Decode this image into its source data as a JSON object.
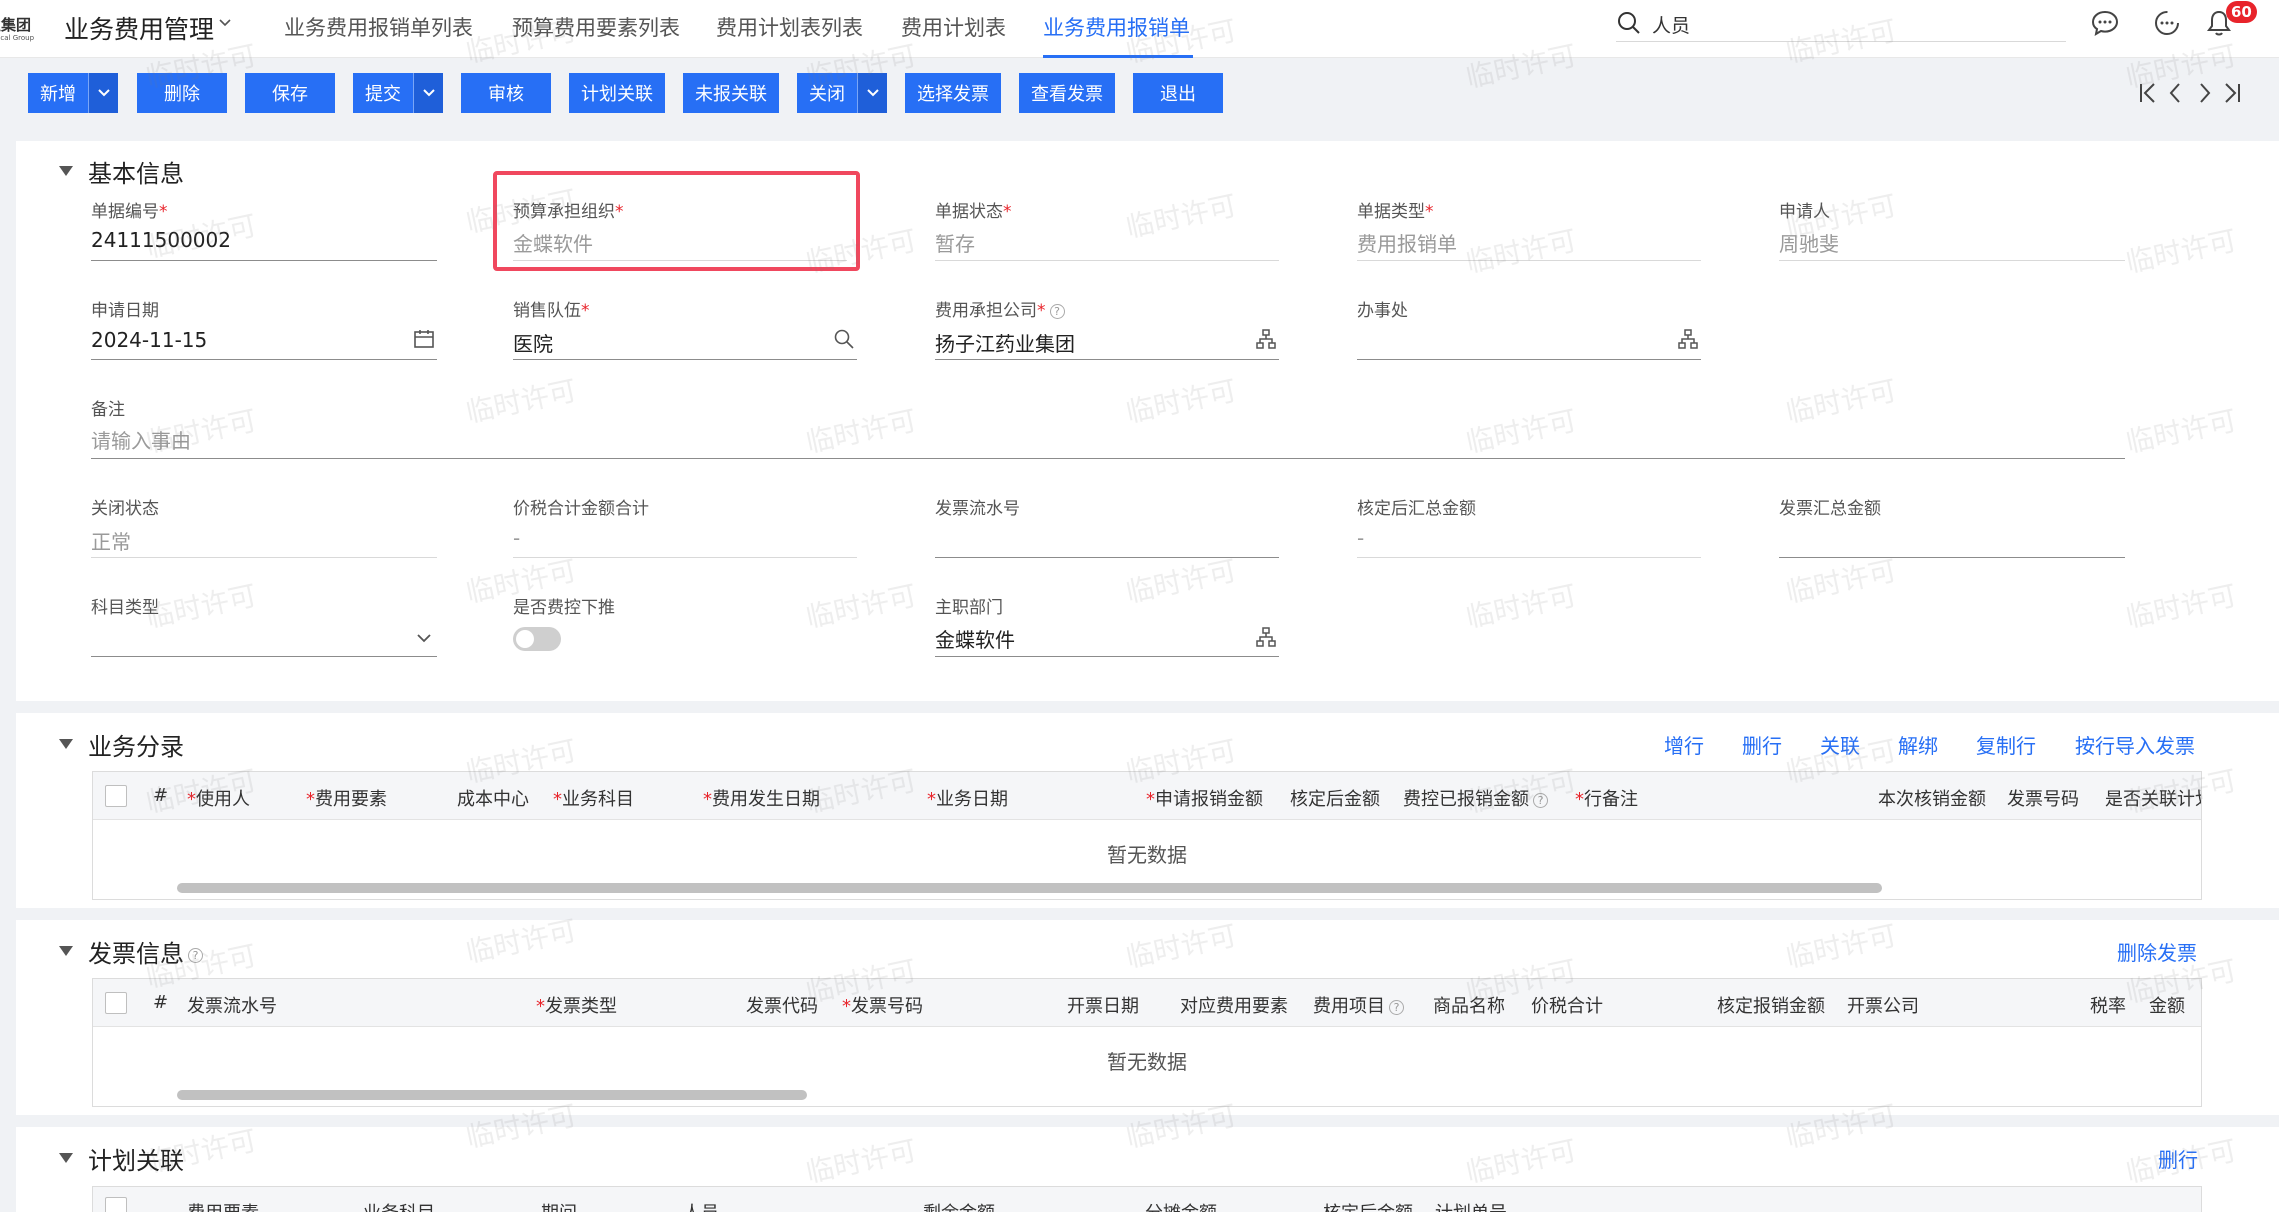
{
  "logo": {
    "main": "业集团",
    "sub": "dical Group"
  },
  "app": {
    "title": "业务费用管理"
  },
  "nav": {
    "tabs": [
      {
        "label": "业务费用报销单列表",
        "active": false
      },
      {
        "label": "预算费用要素列表",
        "active": false
      },
      {
        "label": "费用计划表列表",
        "active": false
      },
      {
        "label": "费用计划表",
        "active": false
      },
      {
        "label": "业务费用报销单",
        "active": true
      }
    ]
  },
  "search": {
    "value": "人员"
  },
  "notifications": {
    "badge": "60"
  },
  "toolbar": {
    "new": "新增",
    "delete": "删除",
    "save": "保存",
    "submit": "提交",
    "audit": "审核",
    "plan_link": "计划关联",
    "unlink_report": "未报关联",
    "close": "关闭",
    "select_invoice": "选择发票",
    "view_invoice": "查看发票",
    "exit": "退出"
  },
  "basic": {
    "title": "基本信息",
    "fields": {
      "doc_no": {
        "label": "单据编号",
        "value": "24111500002"
      },
      "budget_org": {
        "label": "预算承担组织",
        "value": "金蝶软件"
      },
      "doc_status": {
        "label": "单据状态",
        "value": "暂存"
      },
      "doc_type": {
        "label": "单据类型",
        "value": "费用报销单"
      },
      "applicant": {
        "label": "申请人",
        "value": "周驰斐"
      },
      "apply_date": {
        "label": "申请日期",
        "value": "2024-11-15"
      },
      "sales_team": {
        "label": "销售队伍",
        "value": "医院"
      },
      "cost_company": {
        "label": "费用承担公司",
        "value": "扬子江药业集团"
      },
      "office": {
        "label": "办事处",
        "value": ""
      },
      "remark": {
        "label": "备注",
        "placeholder": "请输入事由"
      },
      "close_status": {
        "label": "关闭状态",
        "value": "正常"
      },
      "tax_total": {
        "label": "价税合计金额合计",
        "value": "-"
      },
      "invoice_serial": {
        "label": "发票流水号",
        "value": ""
      },
      "approved_total": {
        "label": "核定后汇总金额",
        "value": "-"
      },
      "invoice_total": {
        "label": "发票汇总金额",
        "value": ""
      },
      "subject_type": {
        "label": "科目类型",
        "value": ""
      },
      "push_down": {
        "label": "是否费控下推",
        "value": false
      },
      "main_dept": {
        "label": "主职部门",
        "value": "金蝶软件"
      }
    }
  },
  "business": {
    "title": "业务分录",
    "actions": [
      "增行",
      "删行",
      "关联",
      "解绑",
      "复制行",
      "按行导入发票"
    ],
    "columns": [
      "#",
      "使用人",
      "费用要素",
      "成本中心",
      "业务科目",
      "费用发生日期",
      "业务日期",
      "申请报销金额",
      "核定后金额",
      "费控已报销金额",
      "行备注",
      "本次核销金额",
      "发票号码",
      "是否关联计划"
    ],
    "empty": "暂无数据"
  },
  "invoice": {
    "title": "发票信息",
    "actions": [
      "删除发票"
    ],
    "columns": [
      "#",
      "发票流水号",
      "发票类型",
      "发票代码",
      "发票号码",
      "开票日期",
      "对应费用要素",
      "费用项目",
      "商品名称",
      "价税合计",
      "核定报销金额",
      "开票公司",
      "税率",
      "金额"
    ],
    "empty": "暂无数据"
  },
  "plan": {
    "title": "计划关联",
    "actions": [
      "删行"
    ],
    "columns": [
      "费用要素",
      "业务科目",
      "期间",
      "人员",
      "剩余金额",
      "分摊金额",
      "核定后金额",
      "计划单号"
    ]
  },
  "watermark": "临时许可",
  "colors": {
    "primary": "#276ff5",
    "required": "#e8242b",
    "highlight": "#f0485e",
    "badge": "#e8242b"
  }
}
